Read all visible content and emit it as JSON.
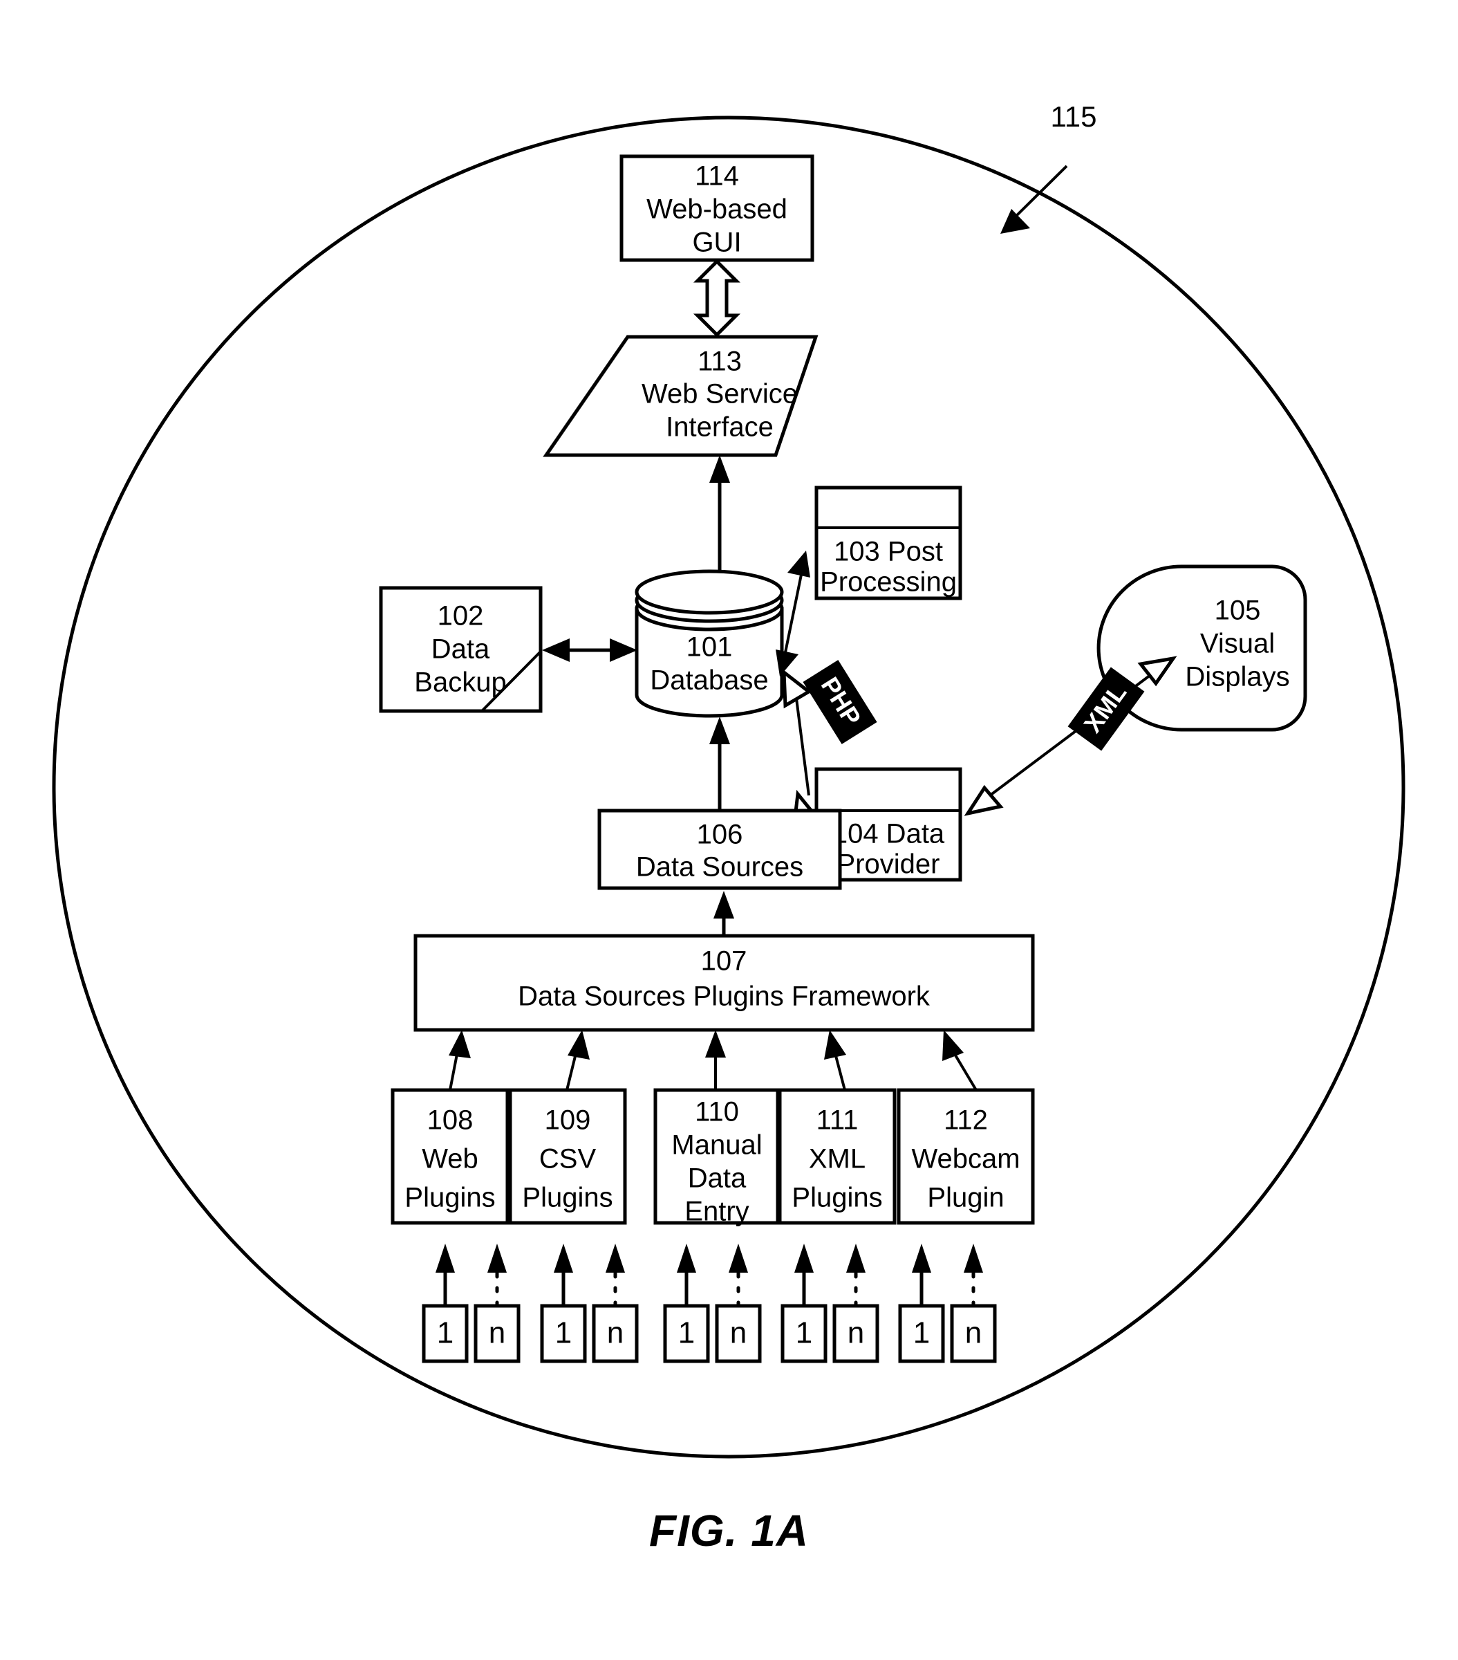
{
  "figure": {
    "caption": "FIG. 1A",
    "system_reference": "115"
  },
  "nodes": {
    "db": {
      "ref": "101",
      "label": "Database"
    },
    "backup": {
      "ref": "102",
      "line1": "Data",
      "line2": "Backup"
    },
    "post": {
      "ref_line": "103 Post",
      "line2": "Processing"
    },
    "provider": {
      "ref_line": "104 Data",
      "line2": "Provider"
    },
    "visual": {
      "ref": "105",
      "line1": "Visual",
      "line2": "Displays"
    },
    "sources": {
      "ref": "106",
      "label": "Data Sources"
    },
    "framework": {
      "ref": "107",
      "label": "Data Sources Plugins Framework"
    },
    "gui": {
      "ref": "114",
      "line1": "Web-based",
      "line2": "GUI"
    },
    "wsi": {
      "ref": "113",
      "line1": "Web Service",
      "line2": "Interface"
    }
  },
  "plugins": [
    {
      "ref": "108",
      "lines": [
        "Web",
        "Plugins"
      ]
    },
    {
      "ref": "109",
      "lines": [
        "CSV",
        "Plugins"
      ]
    },
    {
      "ref": "110",
      "lines": [
        "Manual",
        "Data",
        "Entry"
      ]
    },
    {
      "ref": "111",
      "lines": [
        "XML",
        "Plugins"
      ]
    },
    {
      "ref": "112",
      "lines": [
        "Webcam",
        "Plugin"
      ]
    }
  ],
  "instances": [
    {
      "first": "1",
      "last": "n"
    },
    {
      "first": "1",
      "last": "n"
    },
    {
      "first": "1",
      "last": "n"
    },
    {
      "first": "1",
      "last": "n"
    },
    {
      "first": "1",
      "last": "n"
    }
  ],
  "edge_labels": {
    "php": "PHP",
    "xml": "XML"
  },
  "colors": {
    "stroke": "#000000",
    "fill": "#ffffff",
    "tag_fill": "#000000",
    "tag_text": "#ffffff"
  },
  "chart_data": {
    "type": "diagram",
    "title": "FIG. 1A",
    "description": "System architecture block diagram enclosed in a circular system boundary",
    "blocks": [
      {
        "id": "101",
        "name": "Database",
        "shape": "cylinder"
      },
      {
        "id": "102",
        "name": "Data Backup",
        "shape": "rectangle"
      },
      {
        "id": "103",
        "name": "Post Processing",
        "shape": "window"
      },
      {
        "id": "104",
        "name": "Data Provider",
        "shape": "window"
      },
      {
        "id": "105",
        "name": "Visual Displays",
        "shape": "rounded-blob"
      },
      {
        "id": "106",
        "name": "Data Sources",
        "shape": "rectangle"
      },
      {
        "id": "107",
        "name": "Data Sources Plugins Framework",
        "shape": "rectangle"
      },
      {
        "id": "108",
        "name": "Web Plugins",
        "shape": "rectangle"
      },
      {
        "id": "109",
        "name": "CSV Plugins",
        "shape": "rectangle"
      },
      {
        "id": "110",
        "name": "Manual Data Entry",
        "shape": "rectangle"
      },
      {
        "id": "111",
        "name": "XML Plugins",
        "shape": "rectangle"
      },
      {
        "id": "112",
        "name": "Webcam Plugin",
        "shape": "rectangle"
      },
      {
        "id": "113",
        "name": "Web Service Interface",
        "shape": "parallelogram"
      },
      {
        "id": "114",
        "name": "Web-based GUI",
        "shape": "rectangle"
      },
      {
        "id": "115",
        "name": "System boundary",
        "shape": "circle"
      }
    ],
    "edges": [
      {
        "from": "113",
        "to": "114",
        "style": "hollow-double-arrow"
      },
      {
        "from": "101",
        "to": "113",
        "style": "solid-arrow"
      },
      {
        "from": "101",
        "to": "103",
        "style": "solid-double-arrow"
      },
      {
        "from": "102",
        "to": "101",
        "style": "solid-double-arrow"
      },
      {
        "from": "101",
        "to": "104",
        "style": "hollow-double-arrow",
        "label": "PHP"
      },
      {
        "from": "104",
        "to": "105",
        "style": "hollow-double-arrow",
        "label": "XML"
      },
      {
        "from": "106",
        "to": "101",
        "style": "solid-arrow"
      },
      {
        "from": "107",
        "to": "106",
        "style": "solid-arrow"
      },
      {
        "from": "108",
        "to": "107",
        "style": "solid-arrow"
      },
      {
        "from": "109",
        "to": "107",
        "style": "solid-arrow"
      },
      {
        "from": "110",
        "to": "107",
        "style": "solid-arrow"
      },
      {
        "from": "111",
        "to": "107",
        "style": "solid-arrow"
      },
      {
        "from": "112",
        "to": "107",
        "style": "solid-arrow"
      }
    ]
  }
}
